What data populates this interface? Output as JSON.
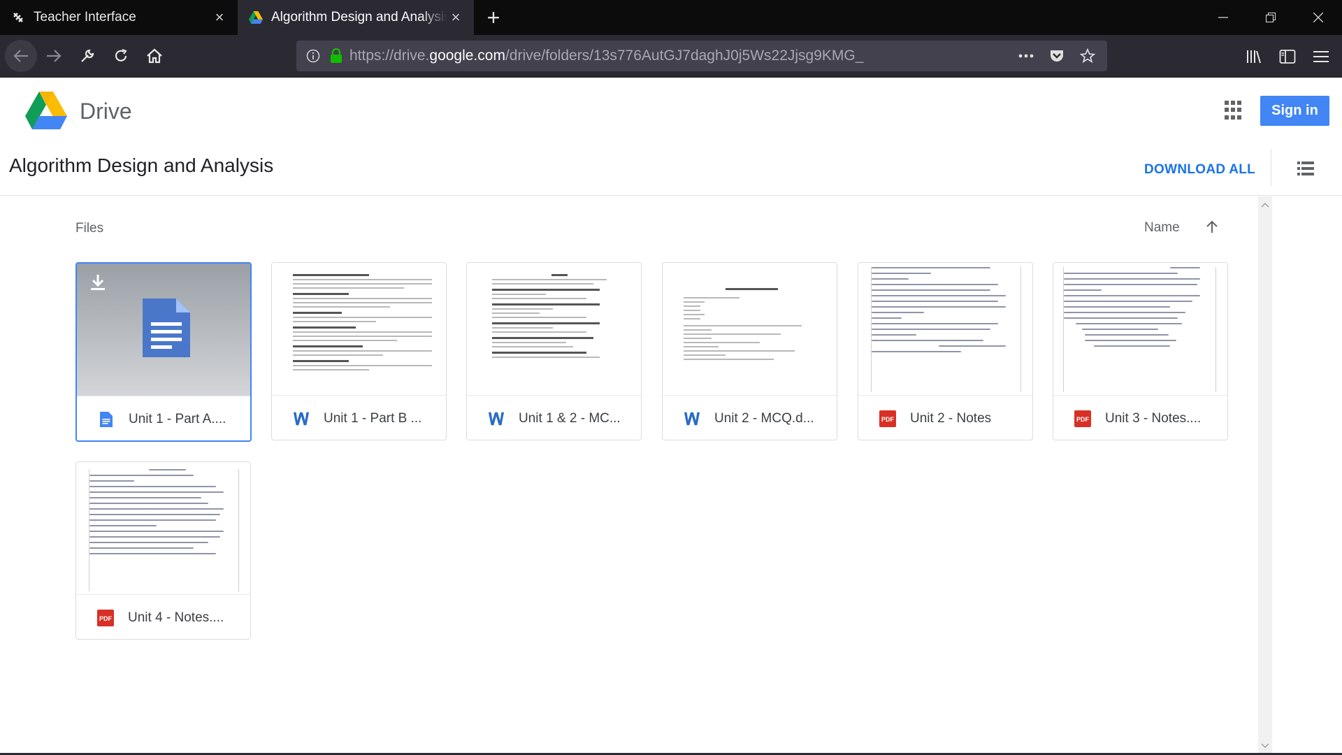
{
  "browser": {
    "tabs": [
      {
        "title": "Teacher Interface",
        "icon": "teacher-icon"
      },
      {
        "title": "Algorithm Design and Analysis",
        "icon": "google-drive-icon"
      }
    ],
    "url_prefix": "https://drive.",
    "url_domain": "google.com",
    "url_path": "/drive/folders/13s776AutGJ7daghJ0j5Ws22Jjsg9KMG_"
  },
  "drive": {
    "app_name": "Drive",
    "sign_in": "Sign in",
    "folder_title": "Algorithm Design and Analysis",
    "download_all": "DOWNLOAD ALL",
    "files_label": "Files",
    "sort_label": "Name"
  },
  "files": [
    {
      "name": "Unit 1 - Part A....",
      "type": "gdoc"
    },
    {
      "name": "Unit 1 - Part B ...",
      "type": "word"
    },
    {
      "name": "Unit 1 & 2 - MC...",
      "type": "word"
    },
    {
      "name": "Unit 2 - MCQ.d...",
      "type": "word"
    },
    {
      "name": "Unit 2 - Notes",
      "type": "pdf"
    },
    {
      "name": "Unit 3 - Notes....",
      "type": "pdf"
    },
    {
      "name": "Unit 4 - Notes....",
      "type": "pdf"
    }
  ],
  "colors": {
    "accent": "#4285f4",
    "download_all": "#1a73e8",
    "pdf": "#d93025",
    "word": "#2b5797"
  }
}
